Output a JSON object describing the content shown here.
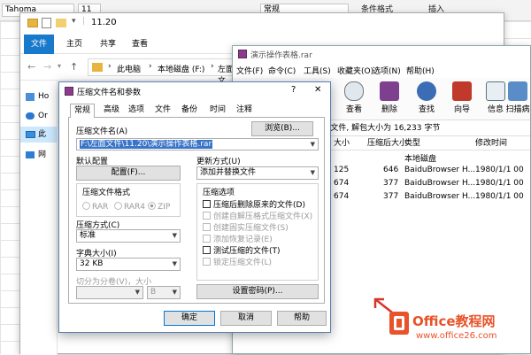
{
  "excel": {
    "font_name": "Tahoma",
    "font_size": "11",
    "format_value": "常规",
    "ribbon_conditional": "条件格式",
    "ribbon_insert": "插入"
  },
  "explorer": {
    "title": "11.20",
    "tabs": [
      "文件",
      "主页",
      "共享",
      "查看"
    ],
    "path": [
      "此电脑",
      "本地磁盘 (F:)",
      "左面文"
    ],
    "nav_items": [
      "Ho",
      "Or",
      "此",
      "网"
    ]
  },
  "winrar": {
    "title": "演示操作表格.rar",
    "menu": [
      "文件(F)",
      "命令(C)",
      "工具(S)",
      "收藏夹(O)",
      "选项(N)",
      "帮助(H)"
    ],
    "tools": [
      "查看",
      "删除",
      "查找",
      "向导",
      "信息",
      "扫描病"
    ],
    "path": "xl\\worksheets - ZIP 压缩文件, 解包大小为 16,233 字节",
    "columns": [
      "大小",
      "压缩后大小",
      "类型",
      "修改时间"
    ],
    "rows": [
      {
        "size": "",
        "packed": "",
        "type": "本地磁盘",
        "modified": ""
      },
      {
        "size": "125",
        "packed": "646",
        "type": "BaiduBrowser H...",
        "modified": "1980/1/1 00"
      },
      {
        "size": "674",
        "packed": "377",
        "type": "BaiduBrowser H...",
        "modified": "1980/1/1 00"
      },
      {
        "size": "674",
        "packed": "377",
        "type": "BaiduBrowser H...",
        "modified": "1980/1/1 00"
      }
    ]
  },
  "dialog": {
    "title": "压缩文件名和参数",
    "help_glyph": "?",
    "close_glyph": "✕",
    "tabs": [
      "常规",
      "高级",
      "选项",
      "文件",
      "备份",
      "时间",
      "注释"
    ],
    "archive_name_label": "压缩文件名(A)",
    "browse_button": "浏览(B)...",
    "archive_name_value": "F:\\左面文件\\11.20\\演示操作表格.rar",
    "default_profile_label": "默认配置",
    "profile_button": "配置(F)...",
    "update_mode_label": "更新方式(U)",
    "update_mode_value": "添加并替换文件",
    "format_label": "压缩文件格式",
    "formats": [
      "RAR",
      "RAR4",
      "ZIP"
    ],
    "method_label": "压缩方式(C)",
    "method_value": "标准",
    "dict_label": "字典大小(I)",
    "dict_value": "32 KB",
    "split_label": "切分为分卷(V)，大小",
    "split_unit": "B",
    "options_label": "压缩选项",
    "options": [
      {
        "label": "压缩后删除原来的文件(D)",
        "enabled": true
      },
      {
        "label": "创建自解压格式压缩文件(X)",
        "enabled": false
      },
      {
        "label": "创建固实压缩文件(S)",
        "enabled": false
      },
      {
        "label": "添加恢复记录(E)",
        "enabled": false
      },
      {
        "label": "测试压缩的文件(T)",
        "enabled": true
      },
      {
        "label": "锁定压缩文件(L)",
        "enabled": false
      }
    ],
    "password_button": "设置密码(P)...",
    "ok_button": "确定",
    "cancel_button": "取消",
    "help_button": "帮助"
  },
  "watermark": {
    "brand": "Office教程网",
    "url": "www.office26.com",
    "accent": "#e8532a"
  }
}
